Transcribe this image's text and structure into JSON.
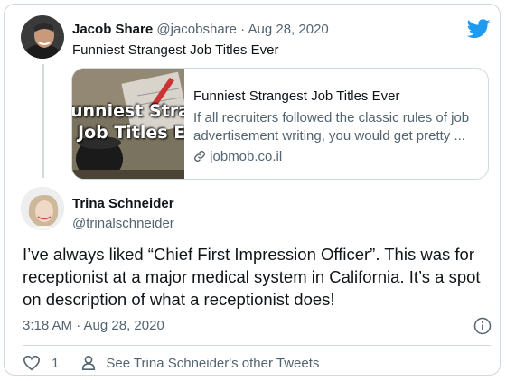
{
  "parent_tweet": {
    "author_name": "Jacob Share",
    "handle": "@jacobshare",
    "separator": " · ",
    "date": "Aug 28, 2020",
    "text": "Funniest Strangest Job Titles Ever",
    "link_card": {
      "thumbnail_line1": "unniest Strange",
      "thumbnail_line2": "Job Titles Eve",
      "title": "Funniest Strangest Job Titles Ever",
      "description": "If all recruiters followed the classic rules of job advertisement writing, you would get pretty ...",
      "domain": "jobmob.co.il"
    }
  },
  "main_tweet": {
    "author_name": "Trina Schneider",
    "handle": "@trinalschneider",
    "text": "I’ve always liked “Chief First Impression Officer”. This was for receptionist at a major medical system in California.  It’s a spot on description of what a receptionist does!",
    "timestamp": "3:18 AM · Aug 28, 2020"
  },
  "actions": {
    "like_count": "1",
    "see_other_tweets": "See Trina Schneider's other Tweets"
  },
  "colors": {
    "twitter_blue": "#1d9bf0",
    "muted_text": "#536471",
    "border": "#cfd9de"
  },
  "icons": [
    "twitter-bird-icon",
    "link-icon",
    "info-icon",
    "heart-icon",
    "person-icon"
  ]
}
